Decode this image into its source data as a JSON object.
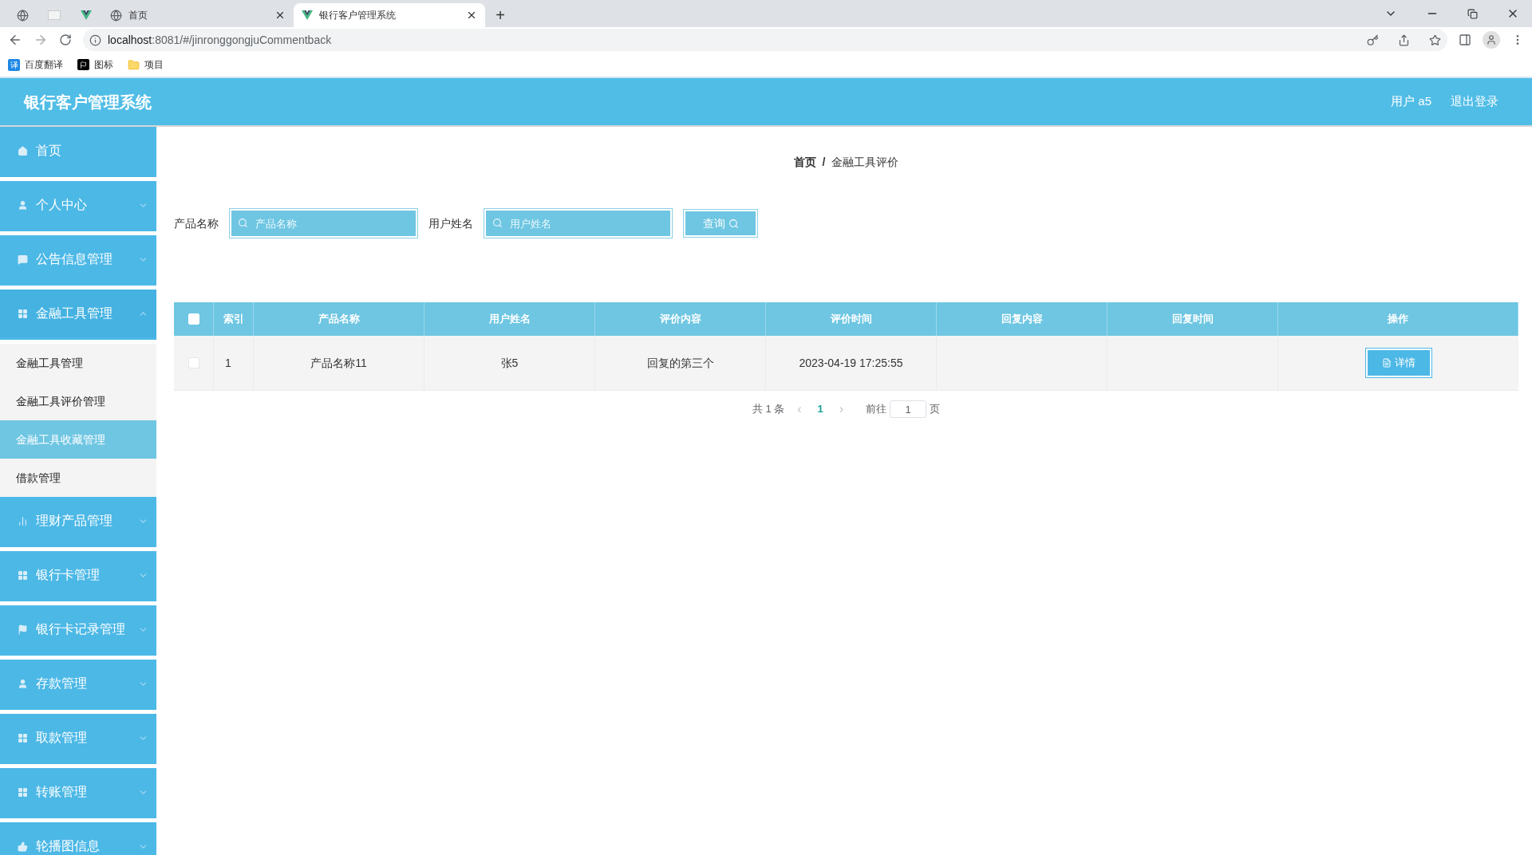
{
  "browser": {
    "tabs": [
      {
        "kind": "pinned",
        "selected": false
      },
      {
        "kind": "blank",
        "selected": false
      },
      {
        "kind": "vue",
        "selected": false
      },
      {
        "kind": "page",
        "title": "首页",
        "selected": false
      },
      {
        "kind": "vue",
        "title": "银行客户管理系统",
        "selected": true
      }
    ],
    "new_tab": "+",
    "url_host": "localhost",
    "url_rest": ":8081/#/jinronggongjuCommentback",
    "bookmarks": [
      {
        "kind": "translate",
        "label": "百度翻译",
        "badge": "译"
      },
      {
        "kind": "flag",
        "label": "图标"
      },
      {
        "kind": "folder",
        "label": "项目"
      }
    ]
  },
  "header": {
    "title": "银行客户管理系统",
    "user": "用户 a5",
    "logout": "退出登录"
  },
  "sidebar": {
    "items": [
      {
        "label": "首页",
        "has_caret": false
      },
      {
        "label": "个人中心",
        "has_caret": true,
        "expanded": false
      },
      {
        "label": "公告信息管理",
        "has_caret": true,
        "expanded": false
      },
      {
        "label": "金融工具管理",
        "has_caret": true,
        "expanded": true,
        "children": [
          {
            "label": "金融工具管理",
            "selected": false
          },
          {
            "label": "金融工具评价管理",
            "selected": false
          },
          {
            "label": "金融工具收藏管理",
            "selected": true
          },
          {
            "label": "借款管理",
            "selected": false
          }
        ]
      },
      {
        "label": "理财产品管理",
        "has_caret": true,
        "expanded": false
      },
      {
        "label": "银行卡管理",
        "has_caret": true,
        "expanded": false
      },
      {
        "label": "银行卡记录管理",
        "has_caret": true,
        "expanded": false
      },
      {
        "label": "存款管理",
        "has_caret": true,
        "expanded": false
      },
      {
        "label": "取款管理",
        "has_caret": true,
        "expanded": false
      },
      {
        "label": "转账管理",
        "has_caret": true,
        "expanded": false
      },
      {
        "label": "轮播图信息",
        "has_caret": true,
        "expanded": false
      }
    ]
  },
  "breadcrumb": {
    "items": [
      "首页",
      "金融工具评价"
    ],
    "separator": "/"
  },
  "search": {
    "fields": [
      {
        "label": "产品名称",
        "placeholder": "产品名称"
      },
      {
        "label": "用户姓名",
        "placeholder": "用户姓名"
      }
    ],
    "button": "查询"
  },
  "table": {
    "header_checked": false,
    "columns": [
      "索引",
      "产品名称",
      "用户姓名",
      "评价内容",
      "评价时间",
      "回复内容",
      "回复时间",
      "操作"
    ],
    "rows": [
      {
        "checked": false,
        "cells": [
          "1",
          "产品名称11",
          "张5",
          "回复的第三个",
          "2023-04-19 17:25:55",
          "",
          ""
        ],
        "action": "详情"
      }
    ]
  },
  "pagination": {
    "total": "共 1 条",
    "prev": "‹",
    "pages": [
      {
        "label": "1",
        "selected": true
      }
    ],
    "next": "›",
    "goto_label": "前往",
    "goto_value": "1",
    "page_unit": "页"
  }
}
